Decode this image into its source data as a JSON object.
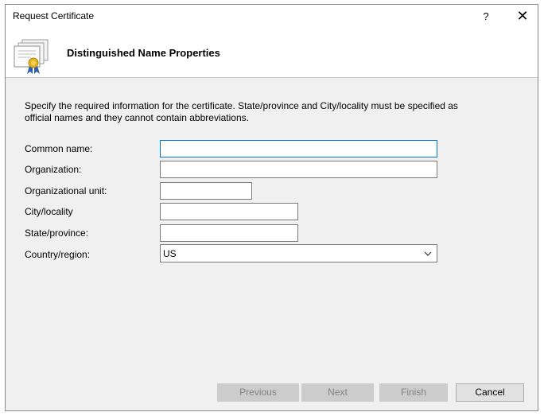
{
  "window": {
    "title": "Request Certificate",
    "help_label": "?",
    "close_label": "✕"
  },
  "header": {
    "title": "Distinguished Name Properties",
    "icon": "certificate-icon"
  },
  "instructions": "Specify the required information for the certificate. State/province and City/locality must be specified as official names and they cannot contain abbreviations.",
  "form": {
    "common_name": {
      "label": "Common name:",
      "value": ""
    },
    "organization": {
      "label": "Organization:",
      "value": ""
    },
    "organizational_unit": {
      "label": "Organizational unit:",
      "value": ""
    },
    "city": {
      "label": "City/locality",
      "value": ""
    },
    "state": {
      "label": "State/province:",
      "value": ""
    },
    "country": {
      "label": "Country/region:",
      "value": "US"
    }
  },
  "footer": {
    "previous": "Previous",
    "next": "Next",
    "finish": "Finish",
    "cancel": "Cancel"
  },
  "colors": {
    "focus_border": "#0078d7",
    "dialog_bg": "#f0f0f0",
    "disabled_text": "#838383"
  }
}
